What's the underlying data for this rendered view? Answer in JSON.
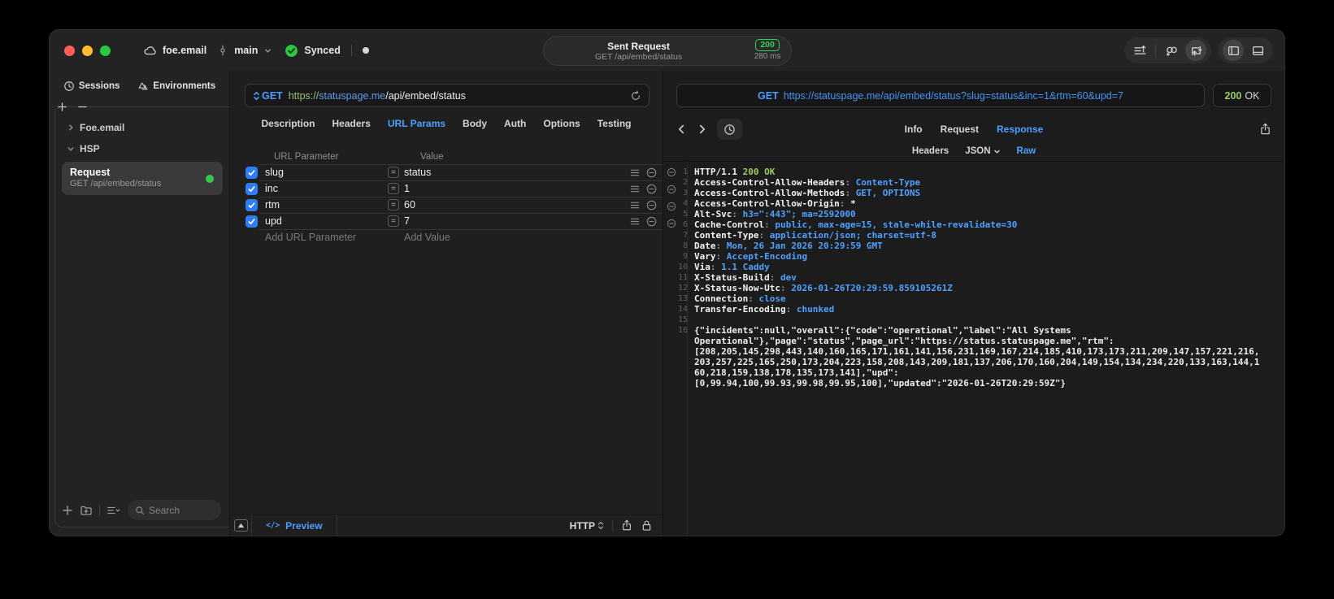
{
  "titlebar": {
    "project": "foe.email",
    "branch": "main",
    "sync_status": "Synced",
    "request_summary": {
      "title": "Sent Request",
      "method_path": "GET /api/embed/status",
      "status_code": "200",
      "duration": "280 ms"
    }
  },
  "sidebar": {
    "tabs": [
      {
        "label": "Sessions",
        "icon": "clock-icon"
      },
      {
        "label": "Environments",
        "icon": "environments-icon"
      }
    ],
    "tree": [
      {
        "label": "Foe.email",
        "expanded": false
      },
      {
        "label": "HSP",
        "expanded": true
      }
    ],
    "request_item": {
      "title": "Request",
      "subtitle": "GET /api/embed/status",
      "status_color": "#32C84B"
    },
    "search_placeholder": "Search"
  },
  "request_pane": {
    "method": "GET",
    "url": {
      "scheme": "https://",
      "host": "statuspage.me",
      "path": "/api/embed/status"
    },
    "tabs": [
      "Description",
      "Headers",
      "URL Params",
      "Body",
      "Auth",
      "Options",
      "Testing"
    ],
    "active_tab": "URL Params",
    "params": {
      "columns": [
        "URL Parameter",
        "Value"
      ],
      "rows": [
        {
          "name": "slug",
          "value": "status",
          "enabled": true
        },
        {
          "name": "inc",
          "value": "1",
          "enabled": true
        },
        {
          "name": "rtm",
          "value": "60",
          "enabled": true
        },
        {
          "name": "upd",
          "value": "7",
          "enabled": true
        }
      ],
      "add_name_placeholder": "Add URL Parameter",
      "add_value_placeholder": "Add Value"
    },
    "footer": {
      "preview_icon": "</>",
      "preview_label": "Preview",
      "protocol": "HTTP"
    }
  },
  "response_pane": {
    "request_line": {
      "method": "GET",
      "url": "https://statuspage.me/api/embed/status?slug=status&inc=1&rtm=60&upd=7"
    },
    "status": {
      "code": "200",
      "text": "OK"
    },
    "tabs": [
      "Info",
      "Request",
      "Response"
    ],
    "active_tab": "Response",
    "subtabs": [
      "Headers",
      "JSON",
      "Raw"
    ],
    "active_subtab": "Raw",
    "code": {
      "lines": [
        {
          "n": "1",
          "s": [
            [
              "HTTP/1.1 ",
              "k"
            ],
            [
              "200 OK",
              "g"
            ]
          ]
        },
        {
          "n": "2",
          "s": [
            [
              "Access-Control-Allow-Headers",
              "k"
            ],
            [
              ": ",
              "c"
            ],
            [
              "Content-Type",
              "v"
            ]
          ]
        },
        {
          "n": "3",
          "s": [
            [
              "Access-Control-Allow-Methods",
              "k"
            ],
            [
              ": ",
              "c"
            ],
            [
              "GET, OPTIONS",
              "v"
            ]
          ]
        },
        {
          "n": "4",
          "s": [
            [
              "Access-Control-Allow-Origin",
              "k"
            ],
            [
              ": ",
              "c"
            ],
            [
              "*",
              "p"
            ]
          ]
        },
        {
          "n": "5",
          "s": [
            [
              "Alt-Svc",
              "k"
            ],
            [
              ": ",
              "c"
            ],
            [
              "h3=\":443\"; ma=2592000",
              "v"
            ]
          ]
        },
        {
          "n": "6",
          "s": [
            [
              "Cache-Control",
              "k"
            ],
            [
              ": ",
              "c"
            ],
            [
              "public, max-age=15, stale-while-revalidate=30",
              "v"
            ]
          ]
        },
        {
          "n": "7",
          "s": [
            [
              "Content-Type",
              "k"
            ],
            [
              ": ",
              "c"
            ],
            [
              "application/json; charset=utf-8",
              "v"
            ]
          ]
        },
        {
          "n": "8",
          "s": [
            [
              "Date",
              "k"
            ],
            [
              ": ",
              "c"
            ],
            [
              "Mon, 26 Jan 2026 20:29:59 GMT",
              "v"
            ]
          ]
        },
        {
          "n": "9",
          "s": [
            [
              "Vary",
              "k"
            ],
            [
              ": ",
              "c"
            ],
            [
              "Accept-Encoding",
              "v"
            ]
          ]
        },
        {
          "n": "10",
          "s": [
            [
              "Via",
              "k"
            ],
            [
              ": ",
              "c"
            ],
            [
              "1.1 Caddy",
              "v"
            ]
          ]
        },
        {
          "n": "11",
          "s": [
            [
              "X-Status-Build",
              "k"
            ],
            [
              ": ",
              "c"
            ],
            [
              "dev",
              "v"
            ]
          ]
        },
        {
          "n": "12",
          "s": [
            [
              "X-Status-Now-Utc",
              "k"
            ],
            [
              ": ",
              "c"
            ],
            [
              "2026-01-26T20:29:59.859105261Z",
              "v"
            ]
          ]
        },
        {
          "n": "13",
          "s": [
            [
              "Connection",
              "k"
            ],
            [
              ": ",
              "c"
            ],
            [
              "close",
              "v"
            ]
          ]
        },
        {
          "n": "14",
          "s": [
            [
              "Transfer-Encoding",
              "k"
            ],
            [
              ": ",
              "c"
            ],
            [
              "chunked",
              "v"
            ]
          ]
        },
        {
          "n": "15",
          "s": []
        },
        {
          "n": "16",
          "s": [
            [
              "{\"incidents\":null,\"overall\":{\"code\":\"operational\",\"label\":\"All Systems",
              "p"
            ]
          ]
        },
        {
          "n": "",
          "s": [
            [
              "Operational\"},\"page\":\"status\",\"page_url\":\"https://status.statuspage.me\",\"rtm\":",
              "p"
            ]
          ]
        },
        {
          "n": "",
          "s": [
            [
              "[208,205,145,298,443,140,160,165,171,161,141,156,231,169,167,214,185,410,173,173,211,209,147,157,221,216,",
              "p"
            ]
          ]
        },
        {
          "n": "",
          "s": [
            [
              "203,257,225,165,250,173,204,223,158,208,143,209,181,137,206,170,160,204,149,154,134,234,220,133,163,144,1",
              "p"
            ]
          ]
        },
        {
          "n": "",
          "s": [
            [
              "60,218,159,138,178,135,173,141],\"upd\":",
              "p"
            ]
          ]
        },
        {
          "n": "",
          "s": [
            [
              "[0,99.94,100,99.93,99.98,99.95,100],\"updated\":\"2026-01-26T20:29:59Z\"}",
              "p"
            ]
          ]
        }
      ]
    }
  },
  "colors": {
    "accent_blue": "#4C9EFF",
    "status_green": "#30D158",
    "code_green": "#9CCB62",
    "checkbox_blue": "#2E7CF6"
  }
}
